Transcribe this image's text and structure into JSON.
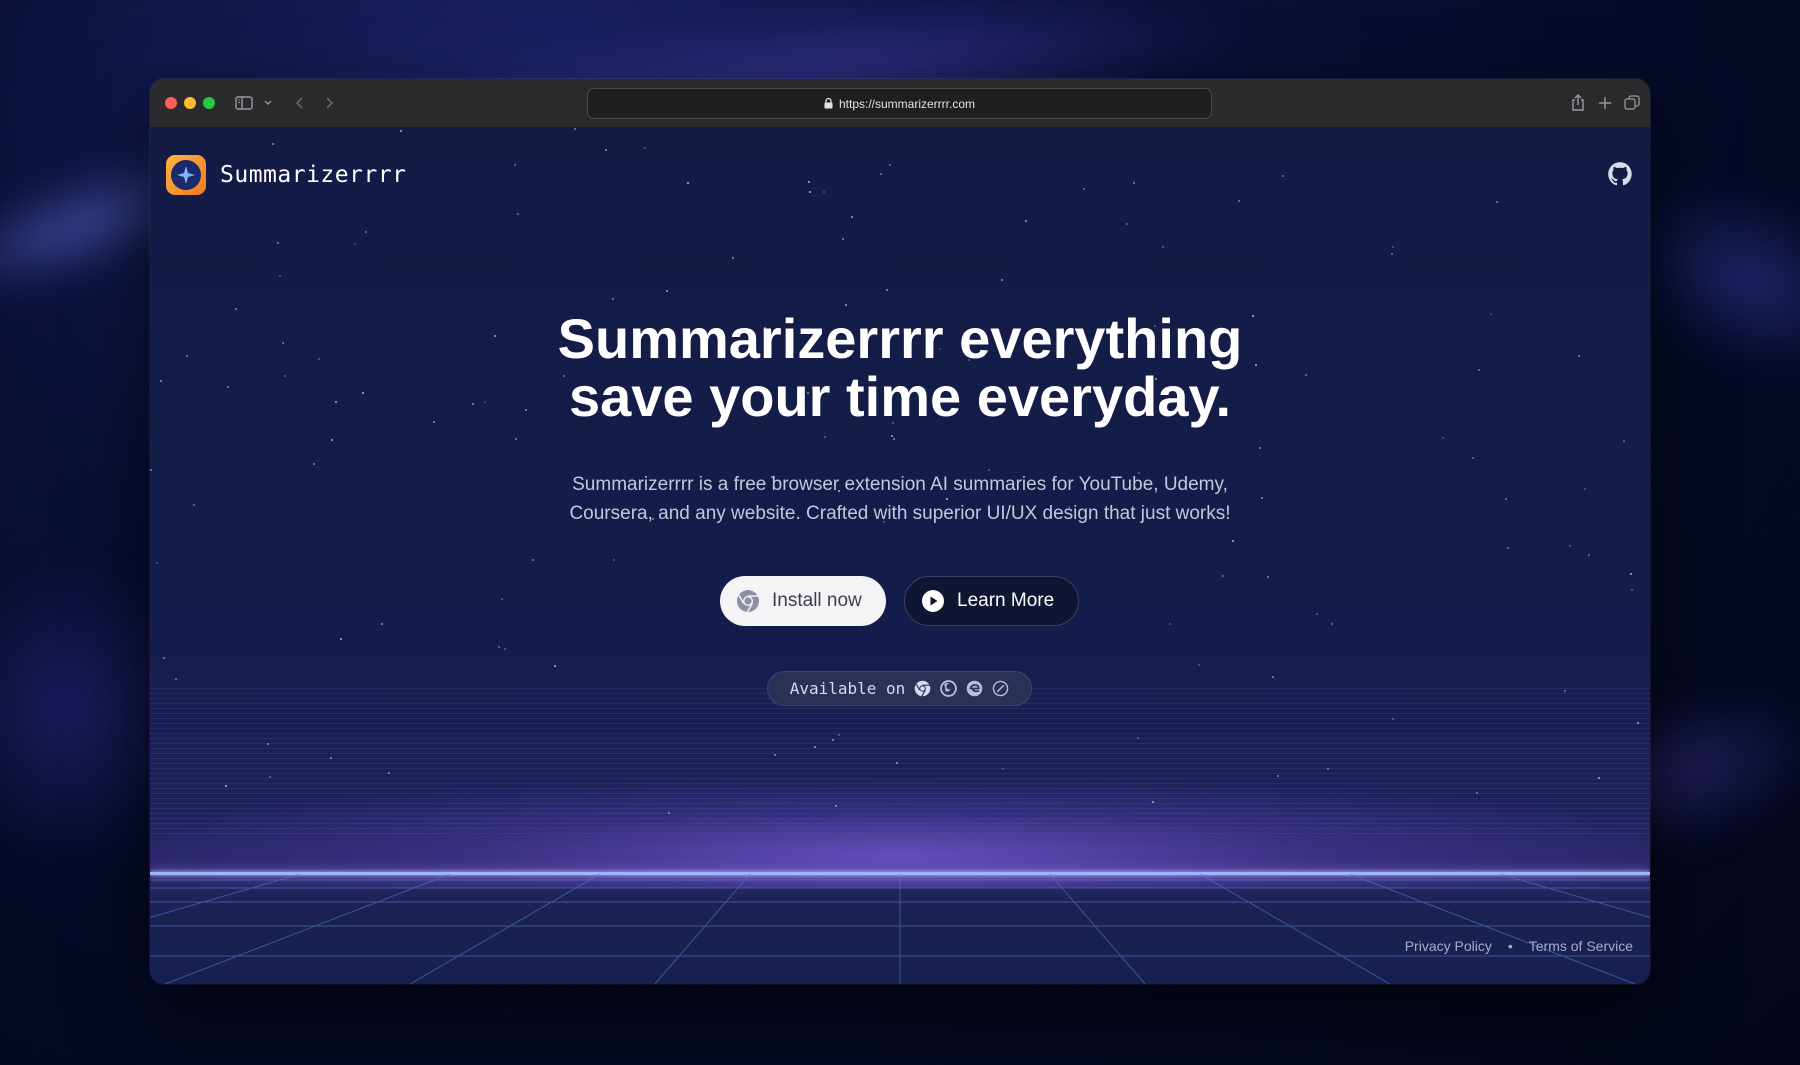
{
  "browser": {
    "url": "https://summarizerrrr.com"
  },
  "site": {
    "brand_name": "Summarizerrrr",
    "hero_title_line1": "Summarizerrrr everything",
    "hero_title_line2": "save your time everyday.",
    "hero_sub_line1": "Summarizerrrr is a free browser extension AI summaries for YouTube, Udemy,",
    "hero_sub_line2": "Coursera, and any website. Crafted with superior UI/UX design that just works!",
    "install_label": "Install now",
    "learn_label": "Learn More",
    "available_label": "Available on",
    "browsers": [
      "chrome-icon",
      "firefox-icon",
      "edge-icon",
      "safari-icon"
    ],
    "footer": {
      "privacy": "Privacy Policy",
      "separator": "•",
      "terms": "Terms of Service"
    }
  },
  "colors": {
    "accent_orange": "#f07a1f",
    "page_bg": "#141c4a",
    "horizon": "#9fb4ff"
  }
}
